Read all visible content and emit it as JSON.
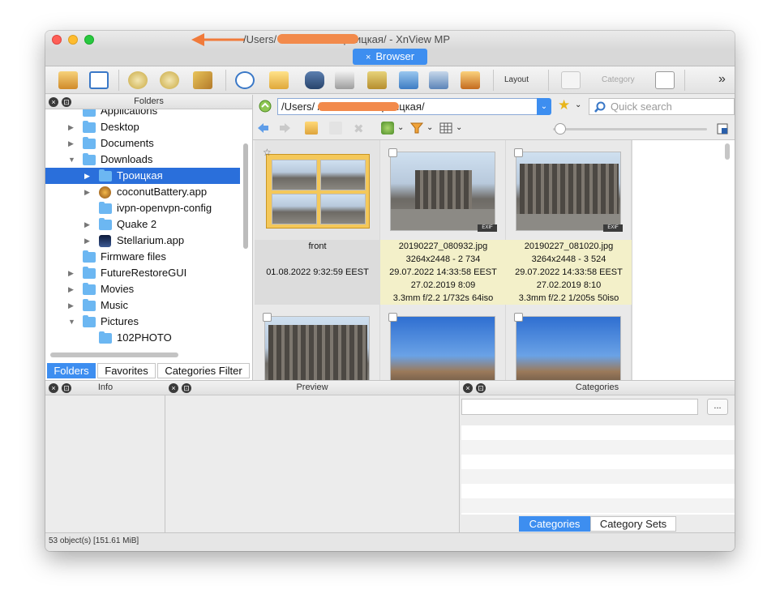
{
  "window": {
    "title": "/Users/                 /Downloads/Троицкая/ - XnView MP"
  },
  "tabs": {
    "browser_label": "Browser",
    "close_glyph": "×"
  },
  "toolbar": {
    "layout_label": "Layout",
    "category_label": "Category",
    "more_glyph": "»"
  },
  "folders_panel": {
    "title": "Folders",
    "items": [
      {
        "label": "Applications",
        "arrow": "",
        "icon": "folder-icon"
      },
      {
        "label": "Desktop",
        "arrow": "▶",
        "icon": "folder-icon"
      },
      {
        "label": "Documents",
        "arrow": "▶",
        "icon": "folder-icon"
      },
      {
        "label": "Downloads",
        "arrow": "▼",
        "icon": "folder-icon"
      },
      {
        "label": "Троицкая",
        "arrow": "▶",
        "icon": "folder-icon"
      },
      {
        "label": "coconutBattery.app",
        "arrow": "▶",
        "icon": "app-icon"
      },
      {
        "label": "ivpn-openvpn-config",
        "arrow": "",
        "icon": "folder-icon"
      },
      {
        "label": "Quake 2",
        "arrow": "▶",
        "icon": "folder-icon"
      },
      {
        "label": "Stellarium.app",
        "arrow": "▶",
        "icon": "app-icon"
      },
      {
        "label": "Firmware files",
        "arrow": "",
        "icon": "folder-icon"
      },
      {
        "label": "FutureRestoreGUI",
        "arrow": "▶",
        "icon": "folder-icon"
      },
      {
        "label": "Movies",
        "arrow": "▶",
        "icon": "folder-icon"
      },
      {
        "label": "Music",
        "arrow": "▶",
        "icon": "folder-icon"
      },
      {
        "label": "Pictures",
        "arrow": "▼",
        "icon": "folder-icon"
      },
      {
        "label": "102PHOTO",
        "arrow": "",
        "icon": "folder-icon"
      }
    ],
    "tabs": [
      "Folders",
      "Favorites",
      "Categories Filter"
    ]
  },
  "address": {
    "path": "/Users/                 /Downloads/Троицкая/",
    "search_placeholder": "Quick search"
  },
  "thumbnails": [
    {
      "name": "front",
      "dims": "",
      "date1": "01.08.2022 9:32:59 EEST",
      "date2": "",
      "exif": ""
    },
    {
      "name": "20190227_080932.jpg",
      "dims": "3264x2448 - 2  734",
      "date1": "29.07.2022 14:33:58 EEST",
      "date2": "27.02.2019 8:09",
      "exif": "3.3mm f/2.2 1/732s 64iso"
    },
    {
      "name": "20190227_081020.jpg",
      "dims": "3264x2448 - 3  524",
      "date1": "29.07.2022 14:33:58 EEST",
      "date2": "27.02.2019 8:10",
      "exif": "3.3mm f/2.2 1/205s 50iso"
    }
  ],
  "exif_badge": "EXIF",
  "bottom": {
    "info_title": "Info",
    "preview_title": "Preview",
    "categories_title": "Categories",
    "more_button": "...",
    "category_tabs": [
      "Categories",
      "Category Sets"
    ]
  },
  "status": {
    "text": "53 object(s) [151.61 MiB]"
  }
}
